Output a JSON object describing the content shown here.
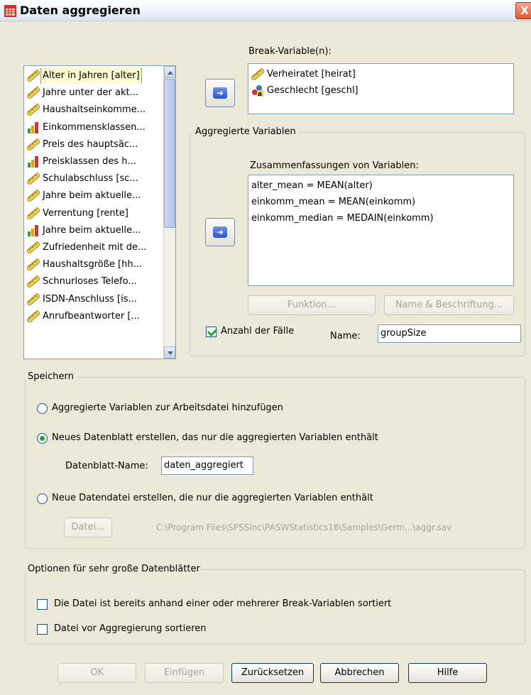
{
  "window": {
    "title": "Daten aggregieren",
    "close_symbol": "X"
  },
  "source_list": {
    "items": [
      {
        "label": "Alter in Jahren [alter]",
        "icon": "scale-ruler-icon"
      },
      {
        "label": "Jahre unter der akt...",
        "icon": "scale-ruler-icon"
      },
      {
        "label": "Haushaltseinkomme...",
        "icon": "scale-ruler-icon"
      },
      {
        "label": "Einkommensklassen...",
        "icon": "ordinal-bars-icon"
      },
      {
        "label": "Preis des hauptsäc...",
        "icon": "scale-ruler-icon"
      },
      {
        "label": "Preisklassen des h...",
        "icon": "ordinal-bars-icon"
      },
      {
        "label": "Schulabschluss [sc...",
        "icon": "scale-ruler-icon"
      },
      {
        "label": "Jahre beim aktuelle...",
        "icon": "scale-ruler-icon"
      },
      {
        "label": "Verrentung [rente]",
        "icon": "scale-ruler-icon"
      },
      {
        "label": "Jahre beim aktuelle...",
        "icon": "ordinal-bars-icon"
      },
      {
        "label": "Zufriedenheit mit de...",
        "icon": "scale-ruler-icon"
      },
      {
        "label": "Haushaltsgröße [hh...",
        "icon": "scale-ruler-icon"
      },
      {
        "label": "Schnurloses Telefo...",
        "icon": "scale-ruler-icon"
      },
      {
        "label": "ISDN-Anschluss [is...",
        "icon": "scale-ruler-icon"
      },
      {
        "label": "Anrufbeantworter [...",
        "icon": "scale-ruler-icon"
      }
    ]
  },
  "break_variables": {
    "label": "Break-Variable(n):",
    "items": [
      {
        "label": "Verheiratet [heirat]",
        "icon": "scale-ruler-icon"
      },
      {
        "label": "Geschlecht [geschl]",
        "icon": "nominal-string-icon"
      }
    ]
  },
  "aggregated": {
    "legend": "Aggregierte Variablen",
    "summaries_label": "Zusammenfassungen von Variablen:",
    "items": [
      "alter_mean = MEAN(alter)",
      "einkomm_mean = MEAN(einkomm)",
      "einkomm_median = MEDAIN(einkomm)"
    ],
    "function_button": "Funktion...",
    "name_label_button": "Name & Beschriftung...",
    "count_checkbox": "Anzahl der Fälle",
    "count_checked": true,
    "name_label": "Name:",
    "name_value": "groupSize"
  },
  "save": {
    "legend": "Speichern",
    "option_add": "Aggregierte Variablen zur Arbeitsdatei hinzufügen",
    "option_new_sheet": "Neues Datenblatt erstellen, das nur die aggregierten Variablen enthält",
    "sheet_name_label": "Datenblatt-Name:",
    "sheet_name_value": "daten_aggregiert",
    "option_new_file": "Neue Datendatei erstellen, die nur die aggregierten Variablen enthält",
    "file_button": "Datei...",
    "file_path": "C:\\Program Files\\SPSSInc\\PASWStatistics18\\Samples\\Germ...\\aggr.sav",
    "selected": "option_new_sheet"
  },
  "large_options": {
    "legend": "Optionen für sehr große Datenblätter",
    "presorted": "Die Datei ist bereits anhand einer oder mehrerer Break-Variablen sortiert",
    "sort_before": "Datei vor Aggregierung sortieren"
  },
  "footer": {
    "ok": "OK",
    "paste": "Einfügen",
    "reset": "Zurücksetzen",
    "cancel": "Abbrechen",
    "help": "Hilfe"
  },
  "colors": {
    "dialog_bg": "#ece9d8",
    "accent_blue": "#2b55c9",
    "checkbox_green": "#21a121"
  }
}
